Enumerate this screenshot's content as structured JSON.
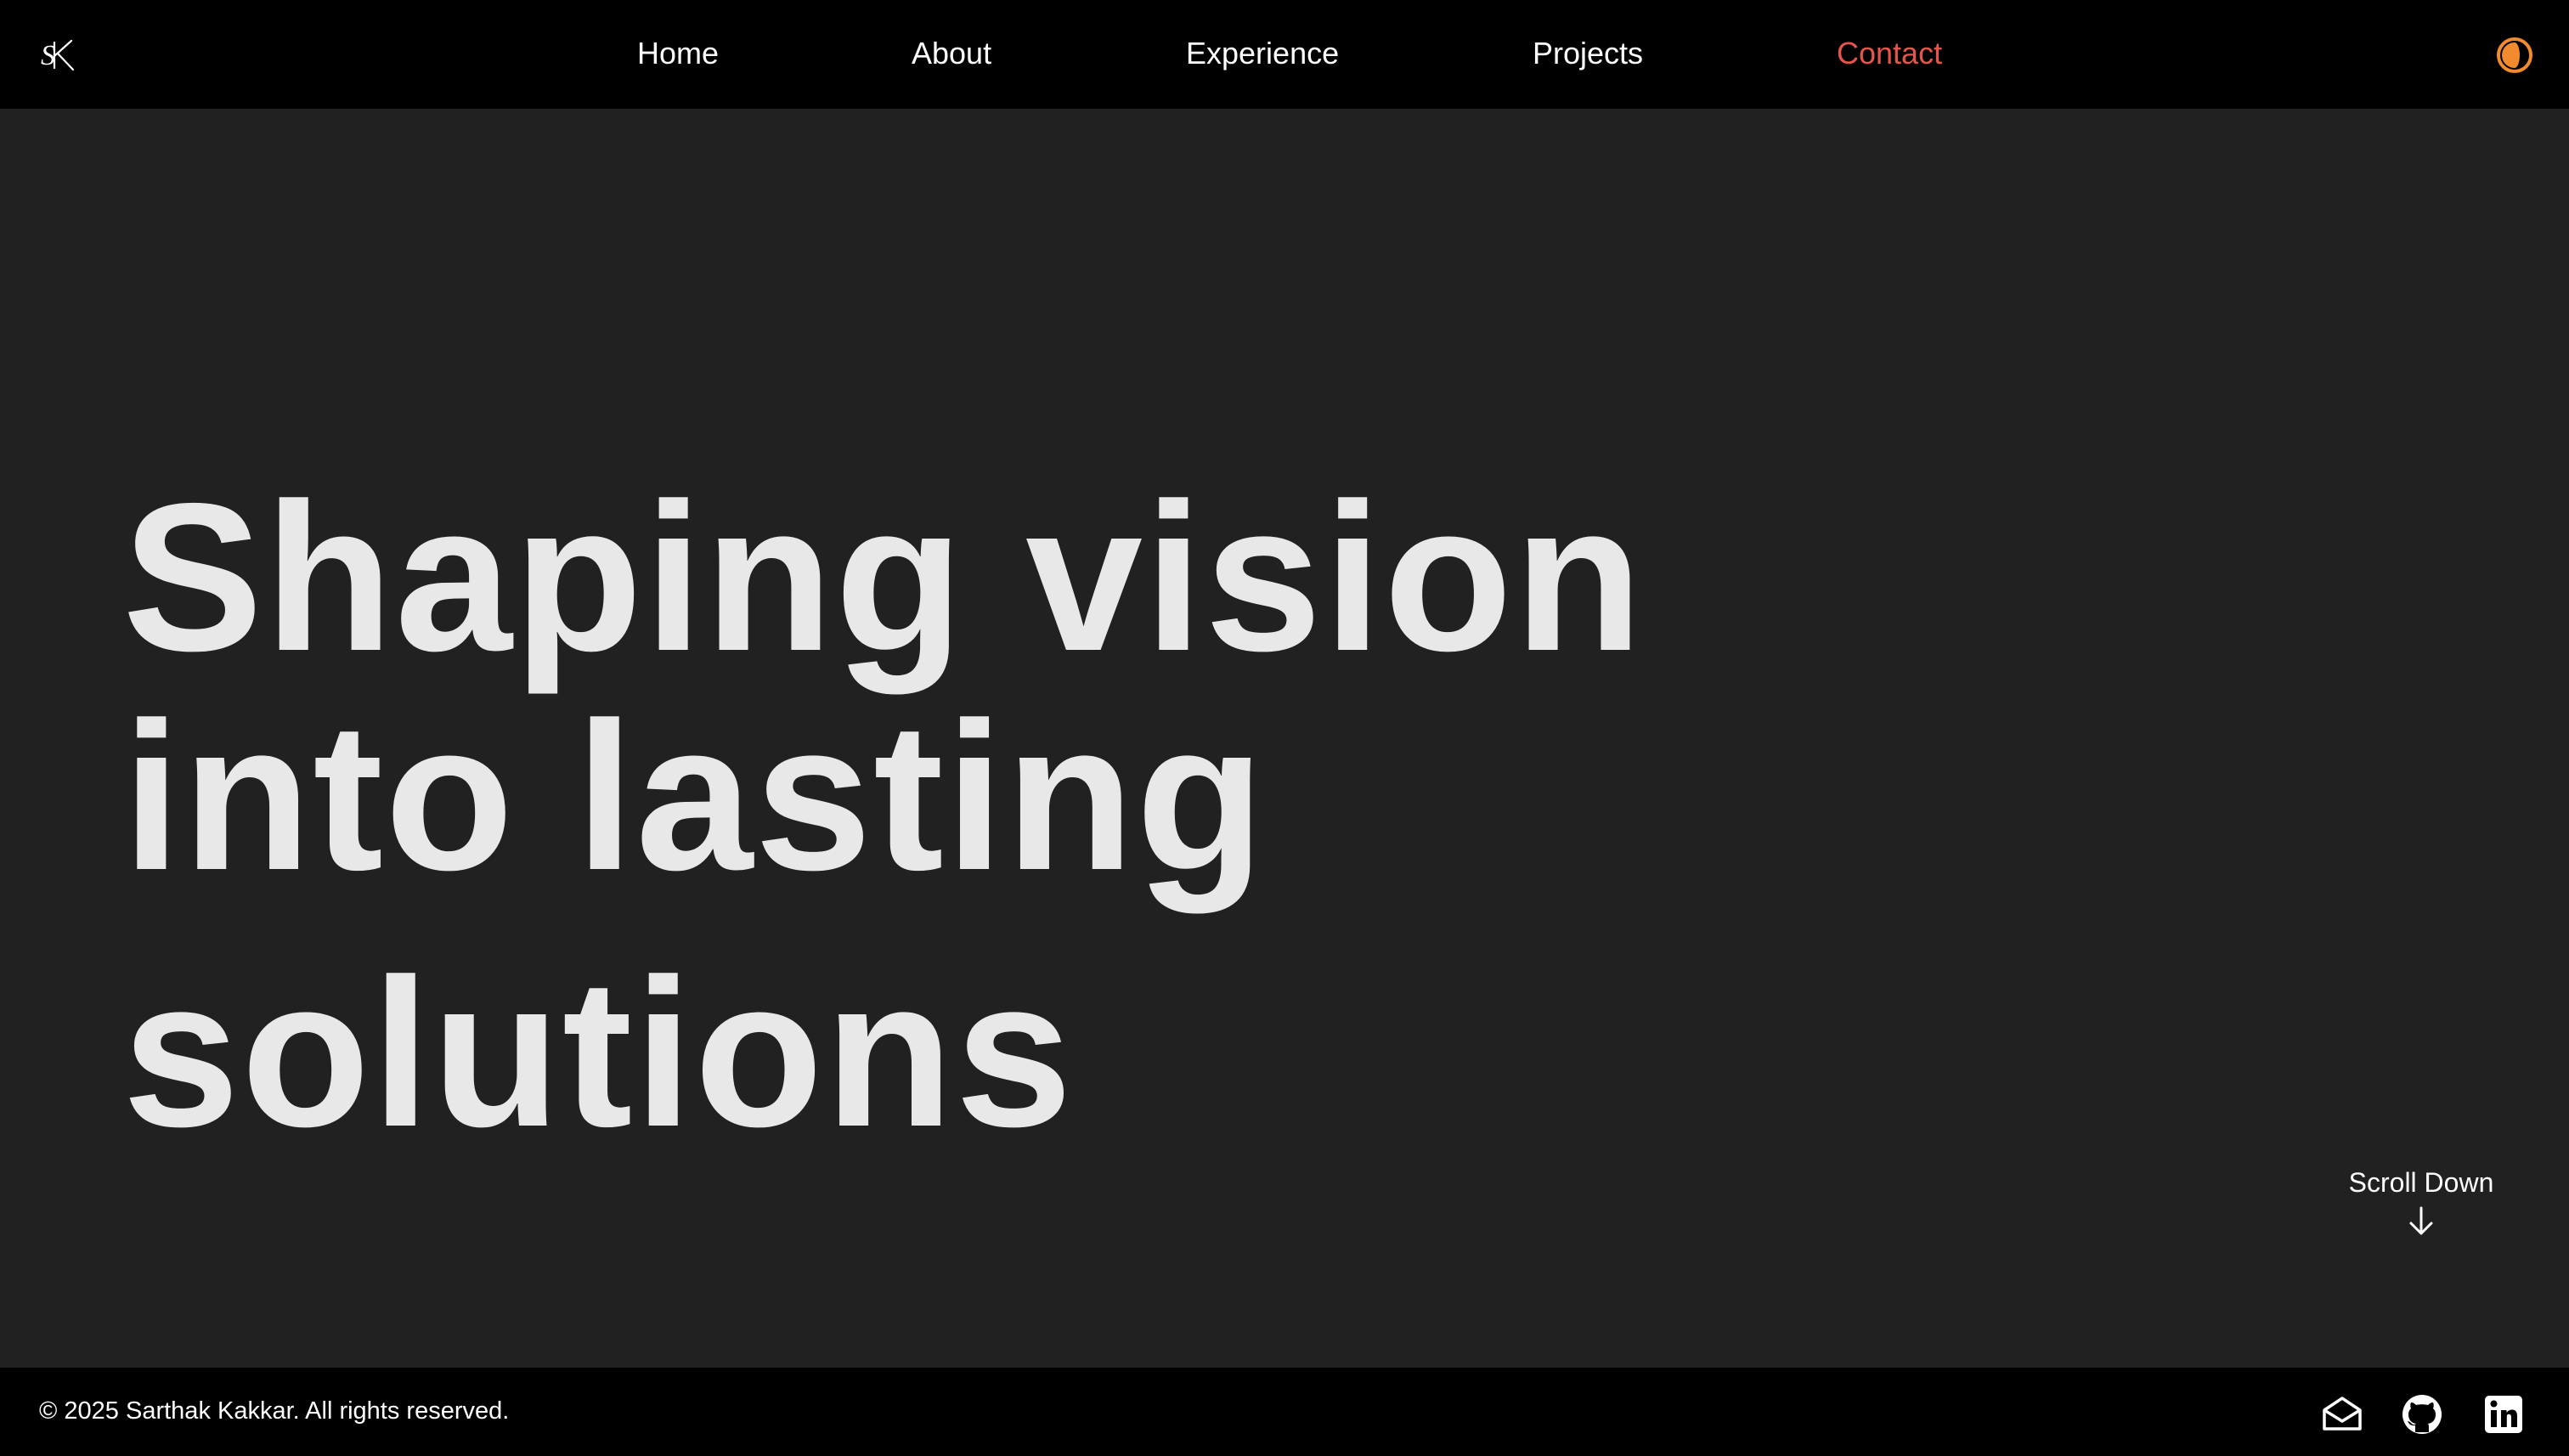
{
  "nav": {
    "logo_text": "SK",
    "links": [
      {
        "label": "Home"
      },
      {
        "label": "About"
      },
      {
        "label": "Experience"
      },
      {
        "label": "Projects"
      },
      {
        "label": "Contact"
      }
    ],
    "active_link": "Contact",
    "theme_toggle_icon": "half-circle-theme-icon"
  },
  "hero": {
    "line1": "Shaping vision",
    "line2": "into lasting",
    "line3": "solutions"
  },
  "scroll": {
    "label": "Scroll Down",
    "icon": "arrow-down-icon"
  },
  "footer": {
    "copyright": "© 2025 Sarthak Kakkar. All rights reserved.",
    "icons": [
      "mail-icon",
      "github-icon",
      "linkedin-icon"
    ]
  },
  "colors": {
    "nav_background": "#000000",
    "page_background": "#212121",
    "hero_text": "#e8e8e8",
    "active_link": "#e5564a",
    "theme_toggle": "#f28a2e",
    "text": "#ffffff"
  }
}
